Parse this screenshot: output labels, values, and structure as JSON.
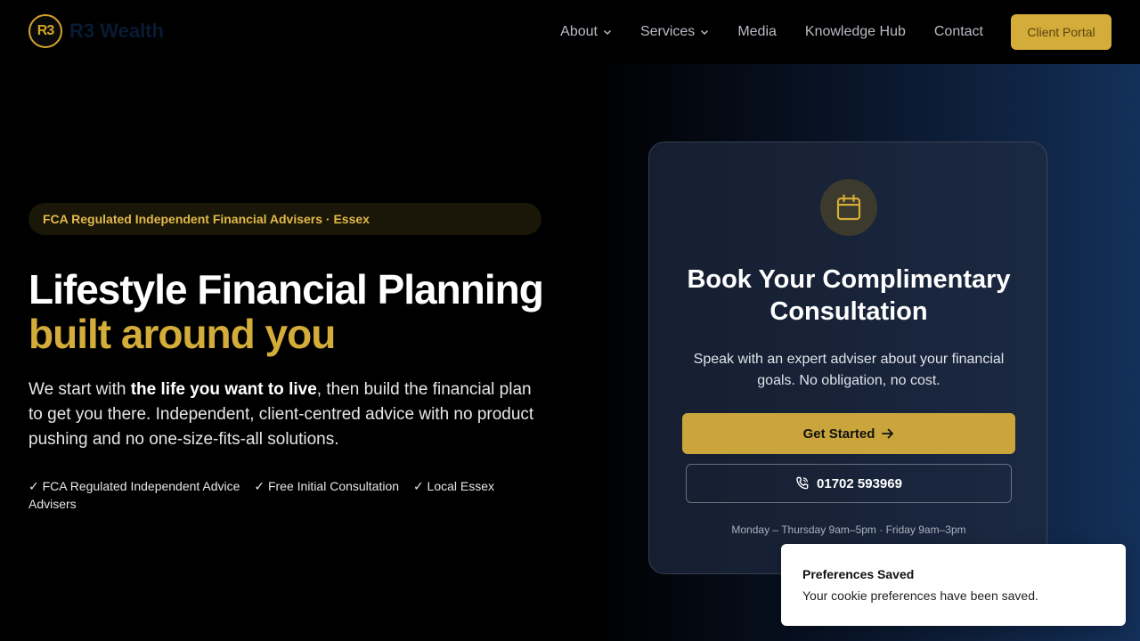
{
  "header": {
    "logo_mark": "R3",
    "logo_text": "R3 Wealth",
    "nav": [
      {
        "label": "About"
      },
      {
        "label": "Services"
      },
      {
        "label": "Media"
      },
      {
        "label": "Knowledge Hub"
      },
      {
        "label": "Contact"
      }
    ],
    "portal_label": "Client Portal"
  },
  "hero": {
    "badge": "FCA Regulated Independent Financial Advisers · Essex",
    "title_line1": "Lifestyle Financial Planning",
    "title_line2": "built around you",
    "lead_before": "We start with ",
    "lead_bold": "the life you want to live",
    "lead_after": ", then build the financial plan to get you there. Independent, client-centred advice with no product pushing and no one-size-fits-all solutions.",
    "checks": [
      "✓ FCA Regulated Independent Advice",
      "✓ Free Initial Consultation",
      "✓ Local Essex Advisers"
    ]
  },
  "card": {
    "icon": "calendar-icon",
    "title": "Book Your Complimentary Consultation",
    "subtitle": "Speak with an expert adviser about your financial goals. No obligation, no cost.",
    "cta_label": "Get Started",
    "phone": "01702 593969",
    "hours": "Monday – Thursday 9am–5pm · Friday 9am–3pm"
  },
  "toast": {
    "title": "Preferences Saved",
    "message": "Your cookie preferences have been saved."
  },
  "colors": {
    "accent": "#d4ac3a",
    "background": "#000000"
  }
}
